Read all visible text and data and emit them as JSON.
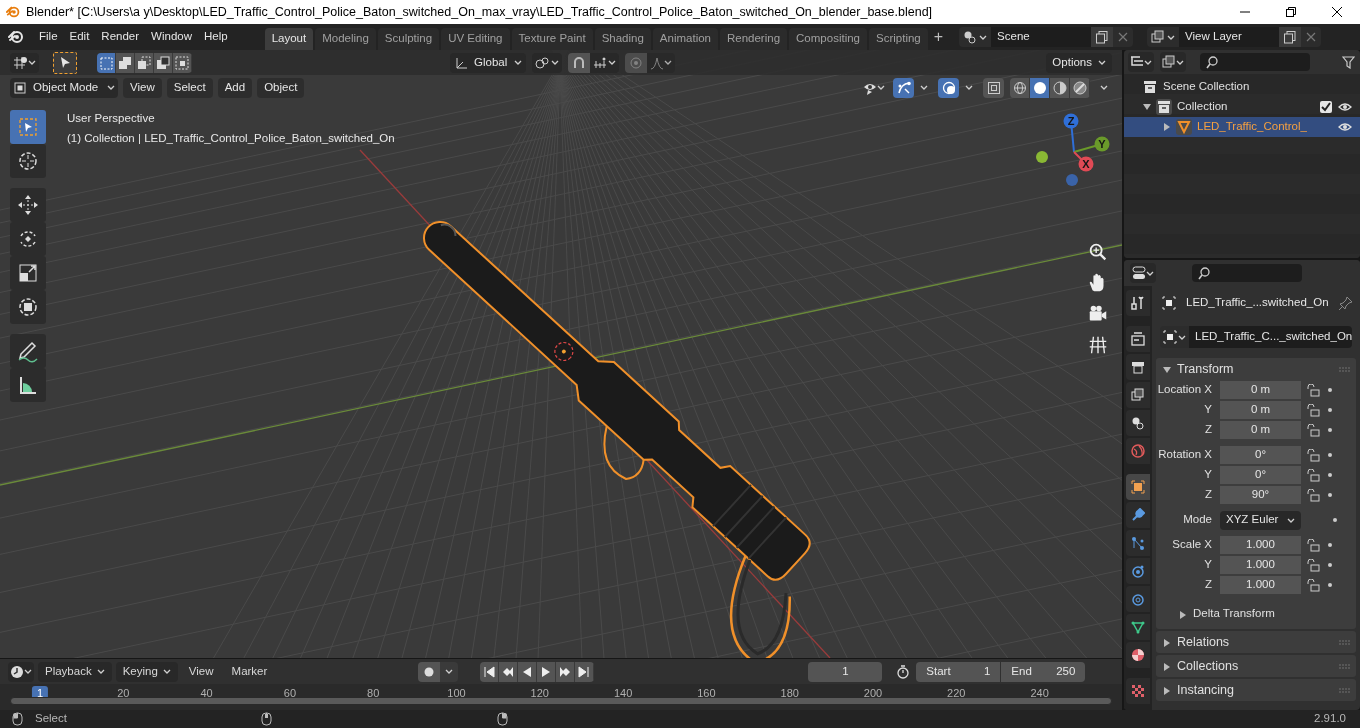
{
  "window": {
    "title": "Blender* [C:\\Users\\a y\\Desktop\\LED_Traffic_Control_Police_Baton_switched_On_max_vray\\LED_Traffic_Control_Police_Baton_switched_On_blender_base.blend]"
  },
  "menu": [
    "File",
    "Edit",
    "Render",
    "Window",
    "Help"
  ],
  "workspaces": [
    {
      "label": "Layout",
      "selected": true
    },
    {
      "label": "Modeling",
      "selected": false
    },
    {
      "label": "Sculpting",
      "selected": false
    },
    {
      "label": "UV Editing",
      "selected": false
    },
    {
      "label": "Texture Paint",
      "selected": false
    },
    {
      "label": "Shading",
      "selected": false
    },
    {
      "label": "Animation",
      "selected": false
    },
    {
      "label": "Rendering",
      "selected": false
    },
    {
      "label": "Compositing",
      "selected": false
    },
    {
      "label": "Scripting",
      "selected": false
    }
  ],
  "add_workspace": "+",
  "scene": "Scene",
  "view_layer": "View Layer",
  "tool_header": {
    "select_modes": [
      {
        "kind": "new",
        "selected": true
      },
      {
        "kind": "extend",
        "selected": false
      },
      {
        "kind": "subtract",
        "selected": false
      },
      {
        "kind": "invert",
        "selected": false
      },
      {
        "kind": "intersect",
        "selected": false
      }
    ],
    "orientation": "Global",
    "options": "Options"
  },
  "viewport_header": {
    "mode": "Object Mode",
    "menus": [
      "View",
      "Select",
      "Add",
      "Object"
    ],
    "toggles": [
      {
        "kind": "gizmo",
        "on": true
      },
      {
        "kind": "overlay",
        "on": true
      },
      {
        "kind": "xray",
        "on": false
      }
    ],
    "shading": [
      {
        "kind": "wireframe",
        "selected": false
      },
      {
        "kind": "solid",
        "selected": true
      },
      {
        "kind": "material",
        "selected": false
      },
      {
        "kind": "rendered",
        "selected": false
      }
    ]
  },
  "viewport": {
    "perspective": "User Perspective",
    "info": "(1) Collection | LED_Traffic_Control_Police_Baton_switched_On",
    "axes": [
      "Z",
      "Y",
      "X"
    ]
  },
  "toolbar": [
    {
      "kind": "select",
      "selected": true
    },
    {
      "kind": "cursor",
      "selected": false
    },
    {
      "kind": "move",
      "selected": false
    },
    {
      "kind": "rotate",
      "selected": false
    },
    {
      "kind": "scale",
      "selected": false
    },
    {
      "kind": "transform",
      "selected": false
    },
    {
      "kind": "annotate",
      "selected": false
    },
    {
      "kind": "measure",
      "selected": false
    }
  ],
  "outliner": {
    "items": [
      {
        "label": "Scene Collection",
        "kind": "scene",
        "children": [
          {
            "label": "Collection",
            "kind": "collection",
            "expanded": true,
            "checked": true,
            "children": [
              {
                "label": "LED_Traffic_Control_",
                "kind": "object",
                "expanded": false,
                "selected": true
              }
            ]
          }
        ]
      }
    ]
  },
  "properties": {
    "tabs": [
      {
        "kind": "tool",
        "selected": false
      },
      {
        "kind": "render",
        "selected": false
      },
      {
        "kind": "output",
        "selected": false
      },
      {
        "kind": "view_layer",
        "selected": false
      },
      {
        "kind": "scene",
        "selected": false
      },
      {
        "kind": "world",
        "selected": false
      },
      {
        "kind": "object",
        "selected": true
      },
      {
        "kind": "modifiers",
        "selected": false
      },
      {
        "kind": "particles",
        "selected": false
      },
      {
        "kind": "physics",
        "selected": false
      },
      {
        "kind": "constraints",
        "selected": false
      },
      {
        "kind": "data",
        "selected": false
      },
      {
        "kind": "material",
        "selected": false
      },
      {
        "kind": "texture",
        "selected": false
      }
    ],
    "object_name": "LED_Traffic_...switched_On",
    "data_name": "LED_Traffic_C..._switched_On",
    "panels": [
      {
        "title": "Transform",
        "expanded": true,
        "rows": [
          {
            "kind": "number",
            "label": "Location X",
            "value": "0 m",
            "gap": false
          },
          {
            "kind": "number",
            "label": "Y",
            "value": "0 m",
            "gap": false
          },
          {
            "kind": "number",
            "label": "Z",
            "value": "0 m",
            "gap": false
          },
          {
            "kind": "number",
            "label": "Rotation X",
            "value": "0°",
            "gap": true
          },
          {
            "kind": "number",
            "label": "Y",
            "value": "0°",
            "gap": false
          },
          {
            "kind": "number",
            "label": "Z",
            "value": "90°",
            "gap": false
          },
          {
            "kind": "dropdown",
            "label": "Mode",
            "value": "XYZ Euler",
            "gap": true
          },
          {
            "kind": "number",
            "label": "Scale X",
            "value": "1.000",
            "gap": true
          },
          {
            "kind": "number",
            "label": "Y",
            "value": "1.000",
            "gap": false
          },
          {
            "kind": "number",
            "label": "Z",
            "value": "1.000",
            "gap": false
          }
        ],
        "subpanels": [
          {
            "title": "Delta Transform",
            "expanded": false
          }
        ]
      },
      {
        "title": "Relations",
        "expanded": false
      },
      {
        "title": "Collections",
        "expanded": false
      },
      {
        "title": "Instancing",
        "expanded": false
      }
    ]
  },
  "timeline": {
    "menus": [
      "Playback",
      "Keying",
      "View",
      "Marker"
    ],
    "current_frame": "1",
    "start": {
      "label": "Start",
      "value": "1"
    },
    "end": {
      "label": "End",
      "value": "250"
    },
    "ruler": [
      {
        "label": "1",
        "selected": true
      },
      {
        "label": "20",
        "selected": false
      },
      {
        "label": "40",
        "selected": false
      },
      {
        "label": "60",
        "selected": false
      },
      {
        "label": "80",
        "selected": false
      },
      {
        "label": "100",
        "selected": false
      },
      {
        "label": "120",
        "selected": false
      },
      {
        "label": "140",
        "selected": false
      },
      {
        "label": "160",
        "selected": false
      },
      {
        "label": "180",
        "selected": false
      },
      {
        "label": "200",
        "selected": false
      },
      {
        "label": "220",
        "selected": false
      },
      {
        "label": "240",
        "selected": false
      }
    ]
  },
  "status_bar": {
    "action": "Select",
    "version": "2.91.0"
  }
}
